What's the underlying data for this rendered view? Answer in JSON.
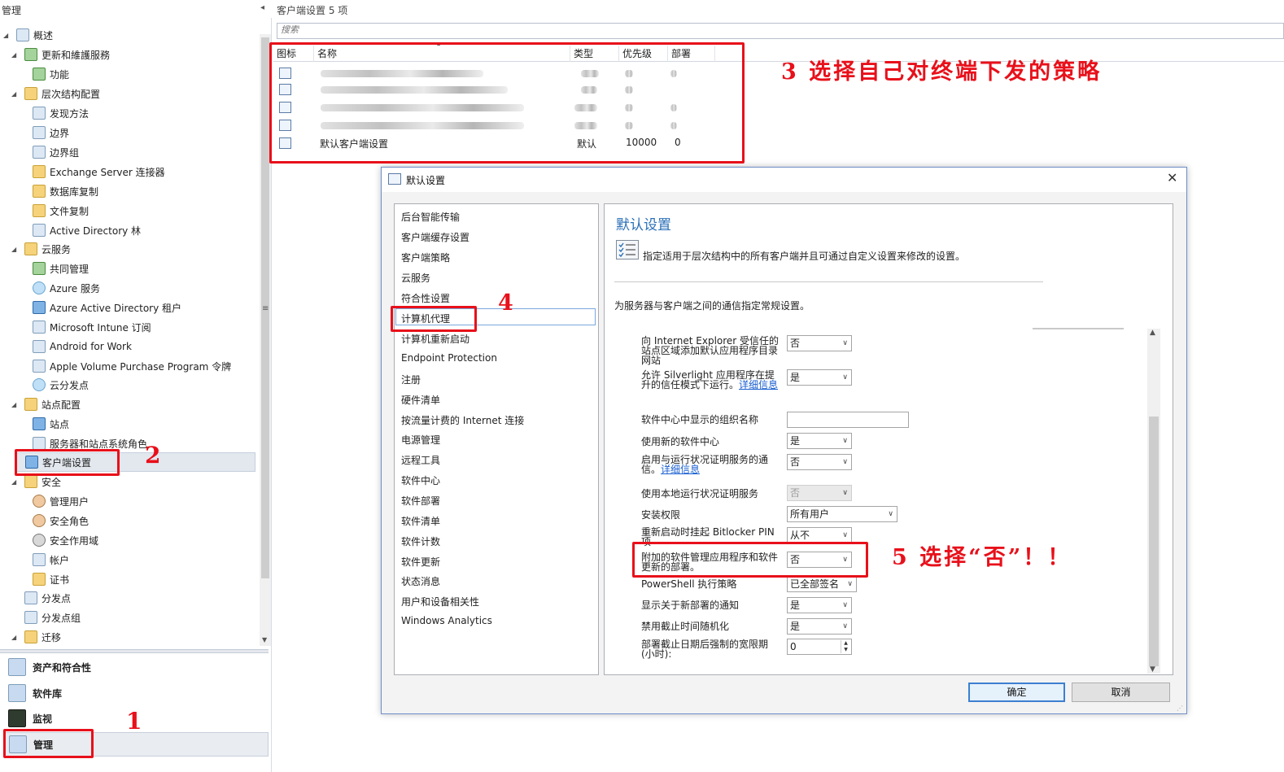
{
  "nav": {
    "title": "管理",
    "tree": [
      {
        "label": "概述"
      },
      {
        "label": "更新和維護服務"
      },
      {
        "label": "功能"
      },
      {
        "label": "层次结构配置"
      },
      {
        "label": "发现方法"
      },
      {
        "label": "边界"
      },
      {
        "label": "边界组"
      },
      {
        "label": "Exchange Server 连接器"
      },
      {
        "label": "数据库复制"
      },
      {
        "label": "文件复制"
      },
      {
        "label": "Active Directory 林"
      },
      {
        "label": "云服务"
      },
      {
        "label": "共同管理"
      },
      {
        "label": "Azure 服务"
      },
      {
        "label": "Azure Active Directory 租户"
      },
      {
        "label": "Microsoft Intune 订阅"
      },
      {
        "label": "Android for Work"
      },
      {
        "label": "Apple Volume Purchase Program 令牌"
      },
      {
        "label": "云分发点"
      },
      {
        "label": "站点配置"
      },
      {
        "label": "站点"
      },
      {
        "label": "服务器和站点系统角色"
      },
      {
        "label": "客户端设置"
      },
      {
        "label": "安全"
      },
      {
        "label": "管理用户"
      },
      {
        "label": "安全角色"
      },
      {
        "label": "安全作用域"
      },
      {
        "label": "帐户"
      },
      {
        "label": "证书"
      },
      {
        "label": "分发点"
      },
      {
        "label": "分发点组"
      },
      {
        "label": "迁移"
      }
    ],
    "workspaces": [
      {
        "label": "资产和符合性"
      },
      {
        "label": "软件库"
      },
      {
        "label": "监视"
      },
      {
        "label": "管理"
      }
    ]
  },
  "list": {
    "title": "客户端设置 5 项",
    "search_placeholder": "搜索",
    "columns": [
      "图标",
      "名称",
      "类型",
      "优先级",
      "部署"
    ],
    "default_row": {
      "name": "默认客户端设置",
      "type": "默认",
      "priority": "10000",
      "deployments": "0"
    }
  },
  "dialog": {
    "title": "默认设置",
    "close_glyph": "✕",
    "nav_items": [
      "后台智能传输",
      "客户端缓存设置",
      "客户端策略",
      "云服务",
      "符合性设置",
      "计算机代理",
      "计算机重新启动",
      "Endpoint Protection",
      "注册",
      "硬件清单",
      "按流量计费的 Internet 连接",
      "电源管理",
      "远程工具",
      "软件中心",
      "软件部署",
      "软件清单",
      "软件计数",
      "软件更新",
      "状态消息",
      "用户和设备相关性",
      "Windows Analytics"
    ],
    "selected_nav": "计算机代理",
    "heading": "默认设置",
    "description": "指定适用于层次结构中的所有客户端并且可通过自定义设置来修改的设置。",
    "subheading": "为服务器与客户端之间的通信指定常规设置。",
    "settings": [
      {
        "label": "向 Internet Explorer 受信任的站点区域添加默认应用程序目录网站",
        "value": "否"
      },
      {
        "label": "允许 Silverlight 应用程序在提升的信任模式下运行。",
        "link": "详细信息",
        "value": "是"
      },
      {
        "label": "软件中心中显示的组织名称",
        "value": ""
      },
      {
        "label": "使用新的软件中心",
        "value": "是"
      },
      {
        "label": "启用与运行状况证明服务的通信。",
        "link": "详细信息",
        "value": "否"
      },
      {
        "label": "使用本地运行状况证明服务",
        "value": "否"
      },
      {
        "label": "安装权限",
        "value": "所有用户"
      },
      {
        "label": "重新启动时挂起 Bitlocker PIN 项",
        "value": "从不"
      },
      {
        "label": "附加的软件管理应用程序和软件更新的部署。",
        "value": "否"
      },
      {
        "label": "PowerShell 执行策略",
        "value": "已全部签名"
      },
      {
        "label": "显示关于新部署的通知",
        "value": "是"
      },
      {
        "label": "禁用截止时间随机化",
        "value": "是"
      },
      {
        "label": "部署截止日期后强制的宽限期(小时):",
        "value": "0"
      }
    ],
    "ok_label": "确定",
    "cancel_label": "取消"
  },
  "annotations": {
    "step1": "1",
    "step2": "2",
    "step3": "3 选择自己对终端下发的策略",
    "step4": "4",
    "step5": "5 选择“否”！！",
    "color": "#e8101a"
  }
}
